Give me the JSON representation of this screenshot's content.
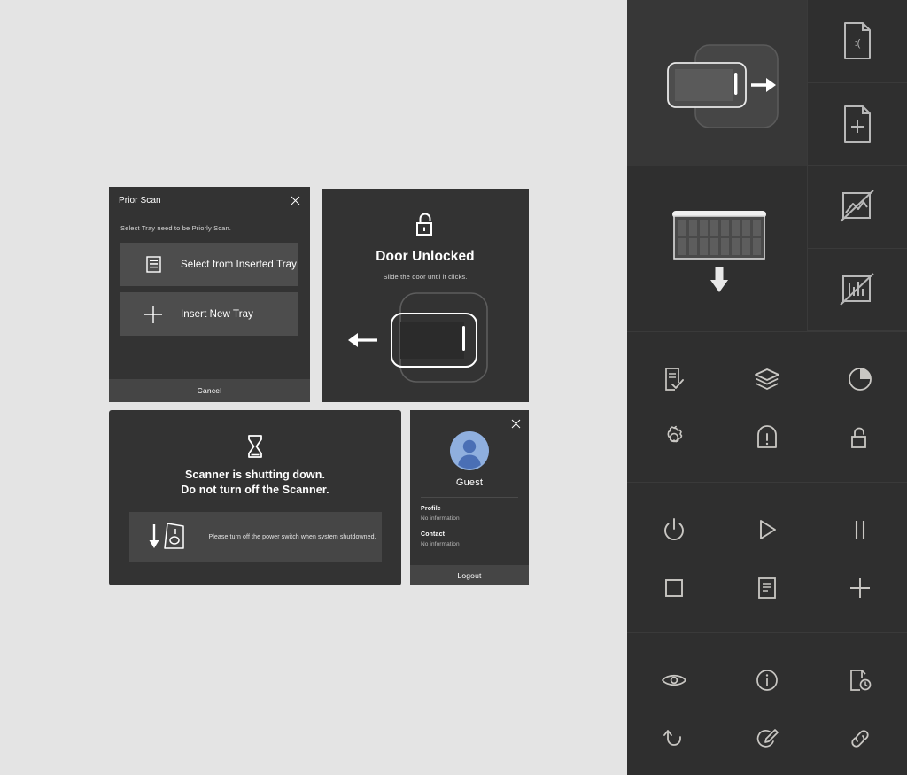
{
  "theme": {
    "page_background": "#e4e4e4",
    "card_background": "#333333",
    "panel_background": "#2f2f2f",
    "button_background": "#4d4d4d",
    "footer_background": "#454545",
    "text_primary": "#ffffff",
    "text_secondary": "#d5d5d5",
    "avatar_circle": "#8fafde",
    "avatar_silhouette": "#4a6fb5",
    "icon_stroke": "#c9c7c3"
  },
  "prior_scan_dialog": {
    "title": "Prior Scan",
    "close_icon": "close-icon",
    "subtitle": "Select Tray need to be Priorly Scan.",
    "options": [
      {
        "label": "Select from Inserted Tray",
        "icon": "tray-list-icon"
      },
      {
        "label": "Insert New Tray",
        "icon": "plus-icon"
      }
    ],
    "cancel_label": "Cancel"
  },
  "door_unlocked_dialog": {
    "icon": "unlock-icon",
    "title": "Door Unlocked",
    "subtitle": "Slide the door until it clicks.",
    "illustration": "door-slide-left-illustration",
    "arrow_direction": "left"
  },
  "shutdown_card": {
    "icon": "hourglass-icon",
    "line1": "Scanner is shutting down.",
    "line2": "Do not turn off the Scanner.",
    "note_icon": "power-switch-down-icon",
    "note_text": "Please turn off the power switch when system shutdowned."
  },
  "profile_card": {
    "close_icon": "close-icon",
    "avatar_icon": "user-avatar",
    "name": "Guest",
    "fields": [
      {
        "label": "Profile",
        "value": "No information"
      },
      {
        "label": "Contact",
        "value": "No information"
      }
    ],
    "logout_label": "Logout"
  },
  "icon_panel": {
    "illustrations": [
      {
        "name": "door-close-illustration",
        "arrow_direction": "right"
      },
      {
        "name": "tray-insert-illustration",
        "arrow_direction": "down"
      }
    ],
    "document_icons": [
      {
        "name": "document-error-icon",
        "glyph": ":("
      },
      {
        "name": "document-add-icon",
        "glyph": "+"
      },
      {
        "name": "no-image-icon",
        "glyph": ""
      },
      {
        "name": "no-histogram-icon",
        "glyph": ""
      }
    ],
    "grids": [
      {
        "name": "grid-section-1",
        "icons": [
          "checklist-icon",
          "layers-icon",
          "pie-chart-icon",
          "gear-icon",
          "door-alert-icon",
          "unlock-icon"
        ]
      },
      {
        "name": "grid-section-2",
        "icons": [
          "power-icon",
          "play-icon",
          "pause-icon",
          "stop-icon",
          "document-lines-icon",
          "plus-icon"
        ]
      },
      {
        "name": "grid-section-3",
        "icons": [
          "eye-icon",
          "info-icon",
          "document-clock-icon",
          "undo-icon",
          "edit-pencil-icon",
          "link-icon"
        ]
      }
    ]
  }
}
